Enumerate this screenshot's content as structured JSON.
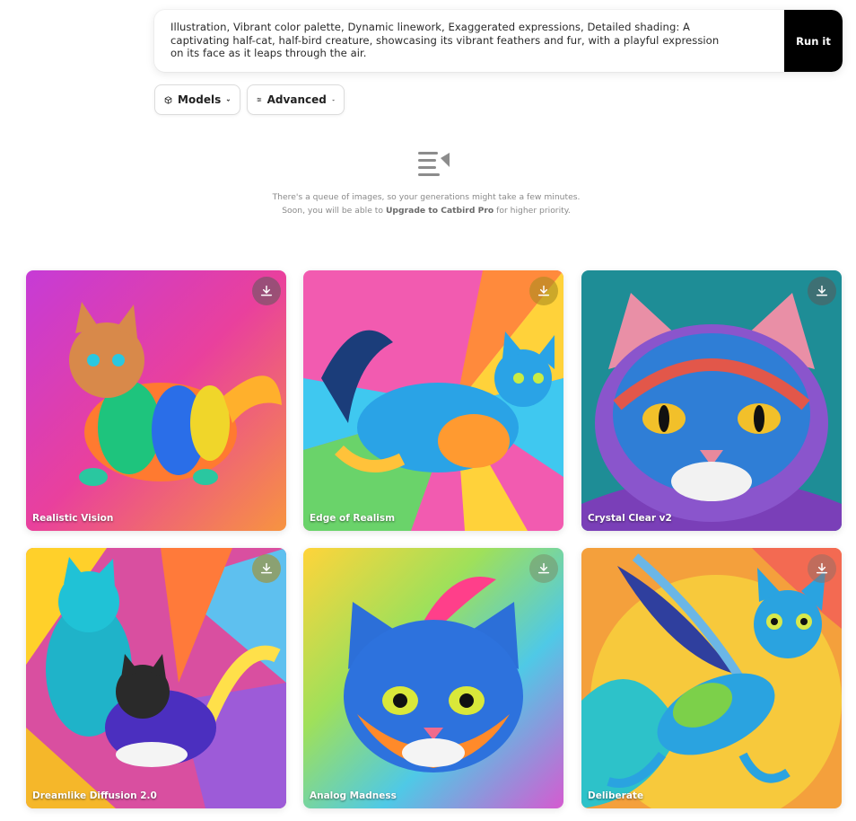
{
  "prompt": {
    "text": "Illustration, Vibrant color palette, Dynamic linework, Exaggerated expressions, Detailed shading: A captivating half-cat, half-bird creature, showcasing its vibrant feathers and fur, with a playful expression on its face as it leaps through the air.",
    "run_label": "Run it"
  },
  "toolbar": {
    "models_label": "Models",
    "advanced_label": "Advanced"
  },
  "queue": {
    "line1": "There's a queue of images, so your generations might take a few minutes.",
    "line2_prefix": "Soon, you will be able to ",
    "line2_link": "Upgrade to Catbird Pro",
    "line2_suffix": " for higher priority."
  },
  "results": [
    {
      "model": "Realistic Vision"
    },
    {
      "model": "Edge of Realism"
    },
    {
      "model": "Crystal Clear v2"
    },
    {
      "model": "Dreamlike Diffusion 2.0"
    },
    {
      "model": "Analog Madness"
    },
    {
      "model": "Deliberate"
    }
  ]
}
